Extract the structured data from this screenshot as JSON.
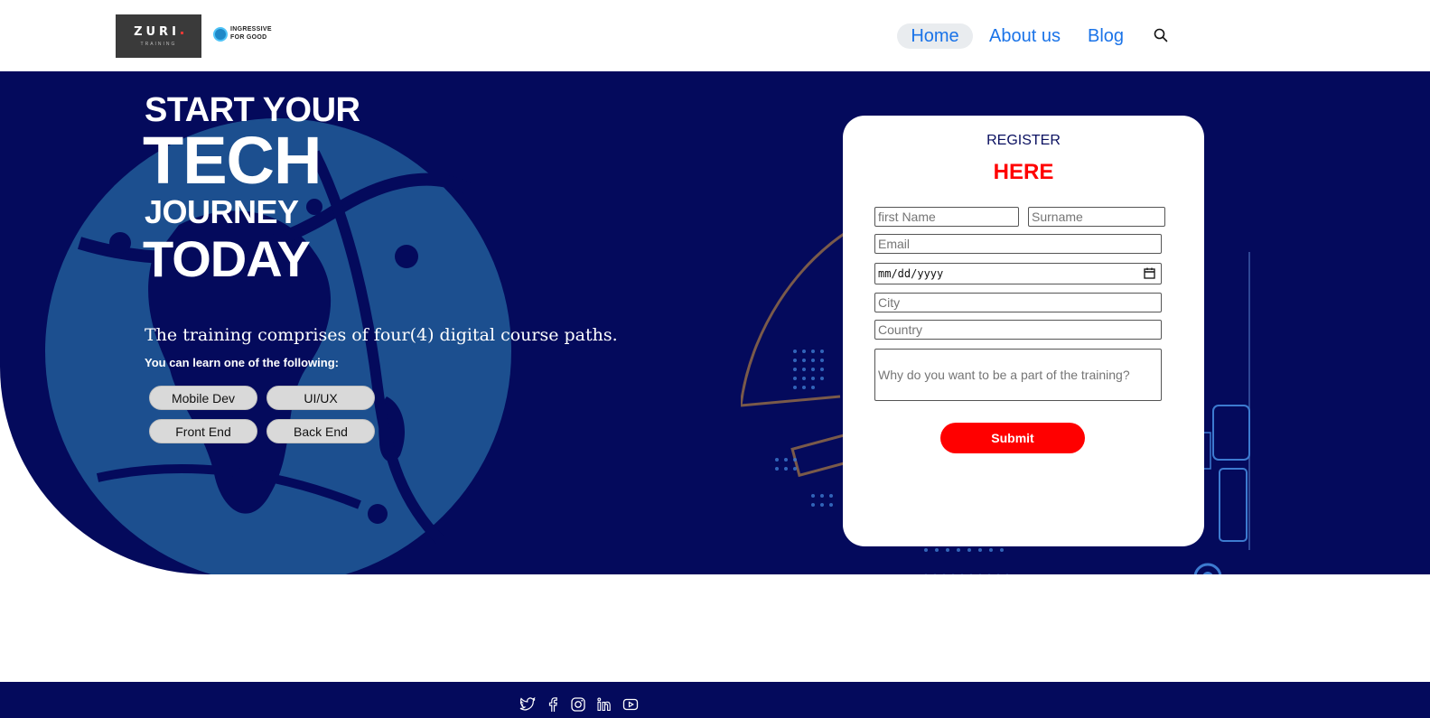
{
  "brand": {
    "zuri_logo_text": "ZURI",
    "zuri_logo_sub": "TRAINING",
    "partner_line1": "INGRESSIVE",
    "partner_line2": "FOR GOOD"
  },
  "nav": {
    "items": [
      {
        "label": "Home",
        "active": true
      },
      {
        "label": "About us"
      },
      {
        "label": "Blog"
      }
    ],
    "search_icon": "search-icon"
  },
  "hero": {
    "line1": "START YOUR",
    "line2": "TECH",
    "line3": "JOURNEY",
    "line4": "TODAY",
    "description": "The training comprises of four(4) digital course paths.",
    "subdescription": "You can learn one of the following:",
    "courses": [
      "Mobile Dev",
      "UI/UX",
      "Front End",
      "Back End"
    ]
  },
  "register": {
    "title": "REGISTER",
    "subtitle": "HERE",
    "fields": {
      "first_name_placeholder": "first Name",
      "surname_placeholder": "Surname",
      "email_placeholder": "Email",
      "date_placeholder": "mm/dd/yyyy",
      "city_placeholder": "City",
      "country_placeholder": "Country",
      "reason_placeholder": "Why do you want to be a part of the training?"
    },
    "submit_label": "Submit"
  },
  "footer": {
    "icons": [
      "twitter-icon",
      "facebook-icon",
      "instagram-icon",
      "linkedin-icon",
      "youtube-icon"
    ]
  },
  "colors": {
    "navy": "#040a5c",
    "link_blue": "#1a73e8",
    "accent_red": "#ff0000",
    "globe_blue": "#1c4f8f"
  }
}
